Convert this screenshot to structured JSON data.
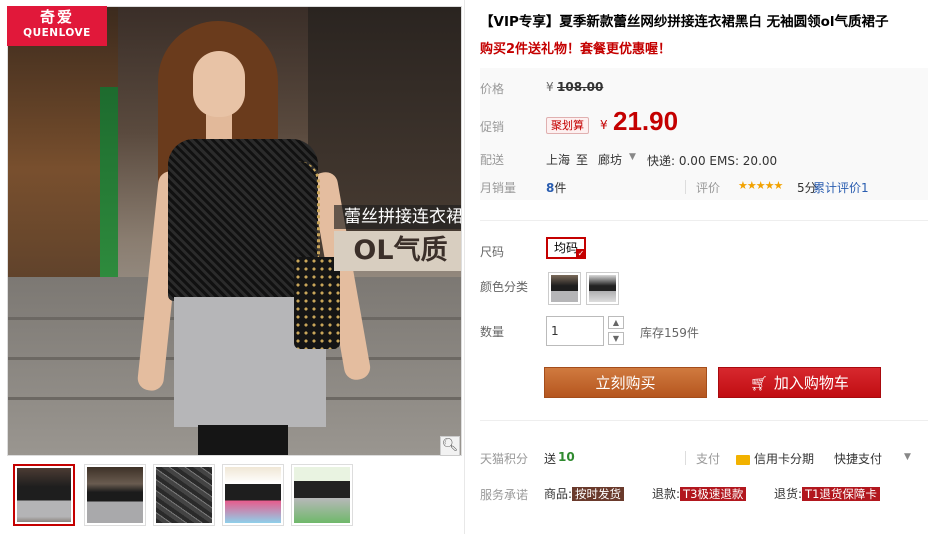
{
  "brand": {
    "name_cn": "奇爱",
    "name_en": "QUENLOVE"
  },
  "gallery": {
    "overlay_line1": "蕾丝拼接连衣裙",
    "overlay_line2": "OL气质",
    "zoom_icon": "magnifier-icon",
    "thumbnails": [
      "thumb-1",
      "thumb-2",
      "thumb-3",
      "thumb-4",
      "thumb-5"
    ],
    "active_thumbnail": 1
  },
  "product": {
    "title": "【VIP专享】夏季新款蕾丝网纱拼接连衣裙黑白 无袖圆领ol气质裙子",
    "promo": "购买2件送礼物！套餐更优惠喔！"
  },
  "price": {
    "label": "价格",
    "currency": "¥",
    "original": "108.00",
    "promo_label": "促销",
    "promo_tag": "聚划算",
    "promo_price": "21.90",
    "shipping_label": "配送",
    "from": "上海",
    "to_word": "至",
    "to": "廊坊",
    "shipping_fees": "快递: 0.00 EMS: 20.00",
    "sales_label": "月销量",
    "sales_count": "8",
    "sales_unit": "件",
    "review_label": "评价",
    "stars": "★★★★★",
    "rating_text": "5分",
    "review_text": "累计评价1"
  },
  "options": {
    "size_label": "尺码",
    "size_value": "均码",
    "color_label": "颜色分类",
    "colors": [
      "color-option-1",
      "color-option-2"
    ],
    "qty_label": "数量",
    "qty_value": "1",
    "stock_text": "库存159件"
  },
  "actions": {
    "buy_now": "立刻购买",
    "add_cart": "加入购物车"
  },
  "points": {
    "label": "天猫积分",
    "prefix": "送",
    "value": "10",
    "pay_label": "支付",
    "installment": "信用卡分期",
    "quick_pay": "快捷支付"
  },
  "service": {
    "label": "服务承诺",
    "goods_prefix": "商品:",
    "goods_badge": "按时发货",
    "refund_prefix": "退款:",
    "refund_badge": "T3极速退款",
    "return_prefix": "退货:",
    "return_badge": "T1退货保障卡"
  },
  "colors": {
    "accent_red": "#c40000",
    "buy_orange": "#c0622c",
    "cart_red": "#c90f14",
    "brand_red": "#e1183a"
  }
}
